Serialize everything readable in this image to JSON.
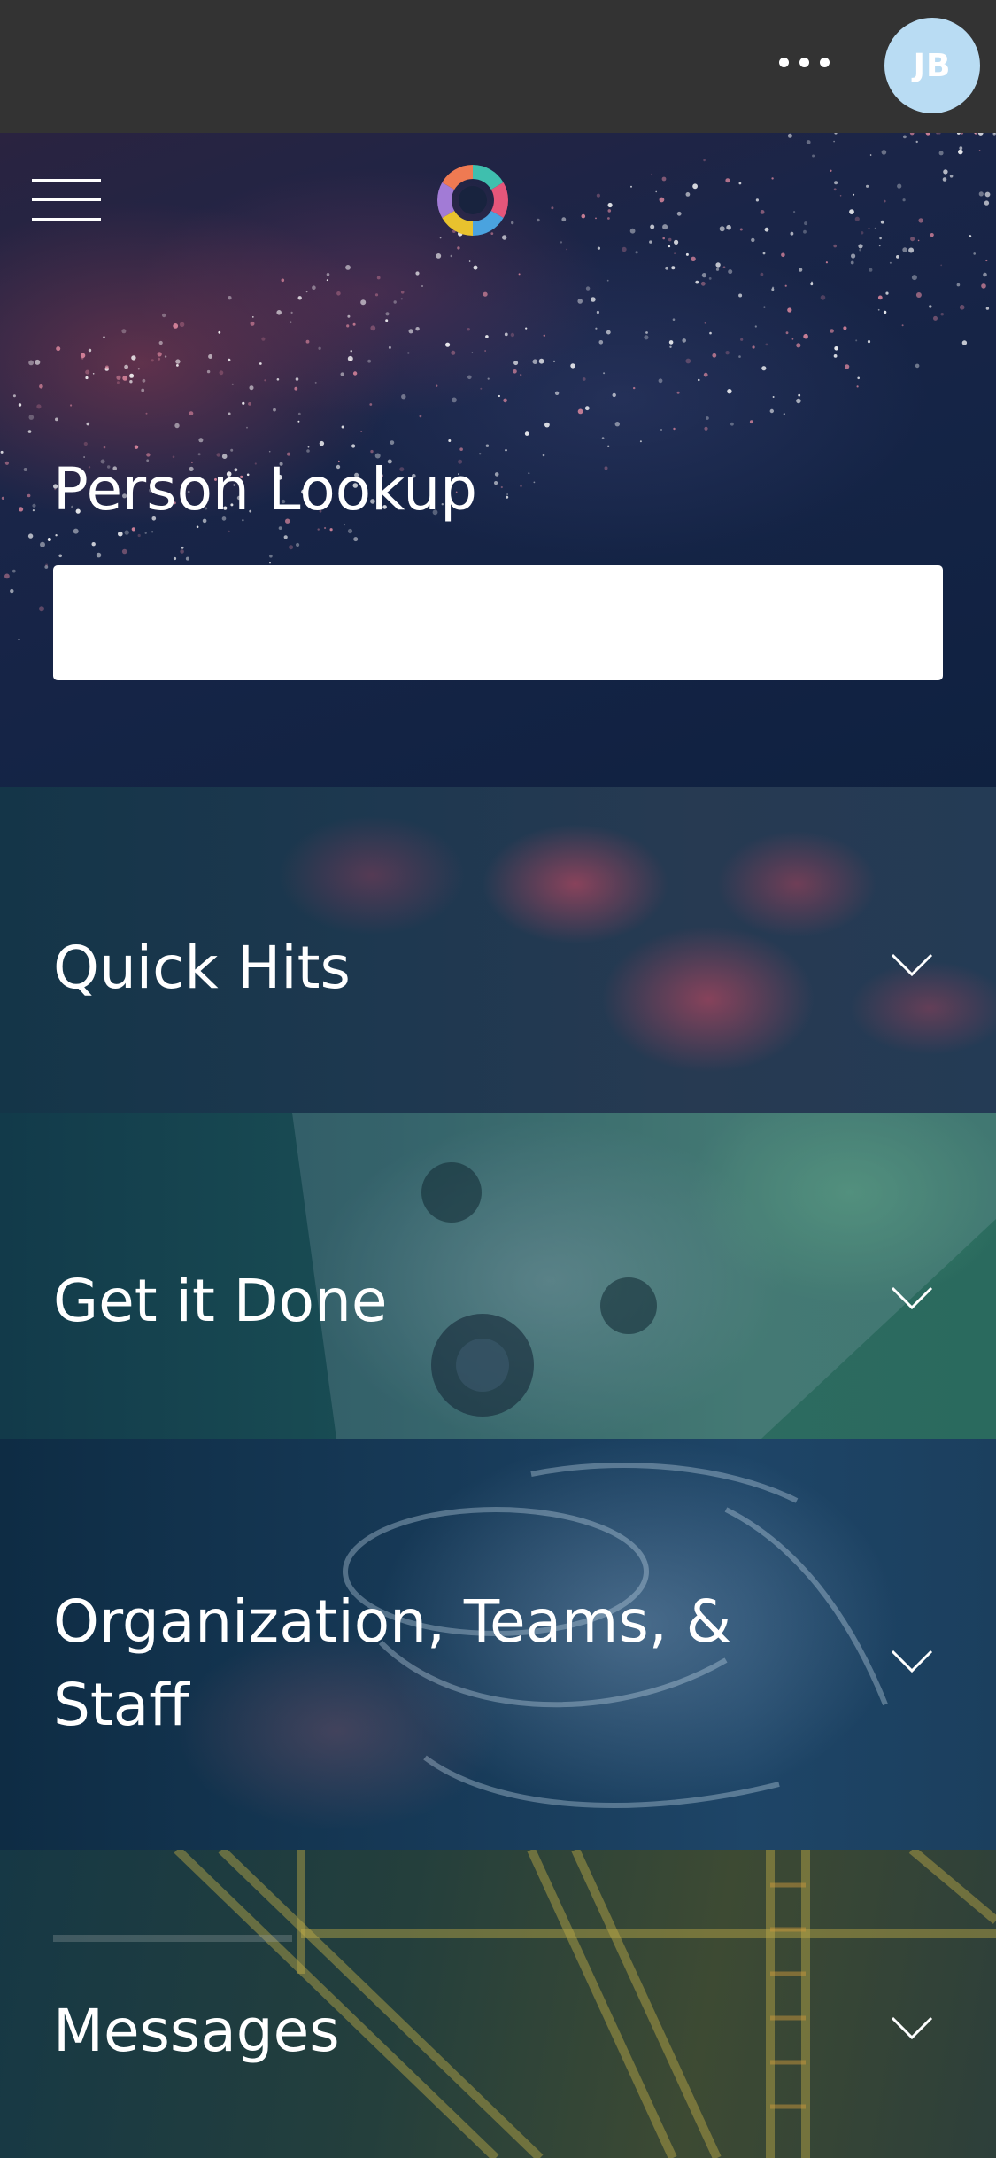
{
  "header": {
    "more_icon": "more-horizontal-icon",
    "avatar_initials": "JB",
    "avatar_color": "#b9dcf3"
  },
  "hero": {
    "menu_icon": "hamburger-menu-icon",
    "logo_icon": "color-wheel-logo",
    "lookup_label": "Person Lookup",
    "lookup_value": "",
    "lookup_placeholder": ""
  },
  "sections": [
    {
      "title": "Quick Hits",
      "chevron_icon": "chevron-down-icon",
      "expanded": false
    },
    {
      "title": "Get it Done",
      "chevron_icon": "chevron-down-icon",
      "expanded": false
    },
    {
      "title": "Organization, Teams, & Staff",
      "chevron_icon": "chevron-down-icon",
      "expanded": false
    },
    {
      "title": "Messages",
      "chevron_icon": "chevron-down-icon",
      "expanded": false
    }
  ],
  "colors": {
    "topbar": "#333333",
    "logo_segments": [
      "#e5567a",
      "#3fbfae",
      "#e8c22e",
      "#4aa3df",
      "#a27bd6",
      "#ef7a52"
    ]
  }
}
